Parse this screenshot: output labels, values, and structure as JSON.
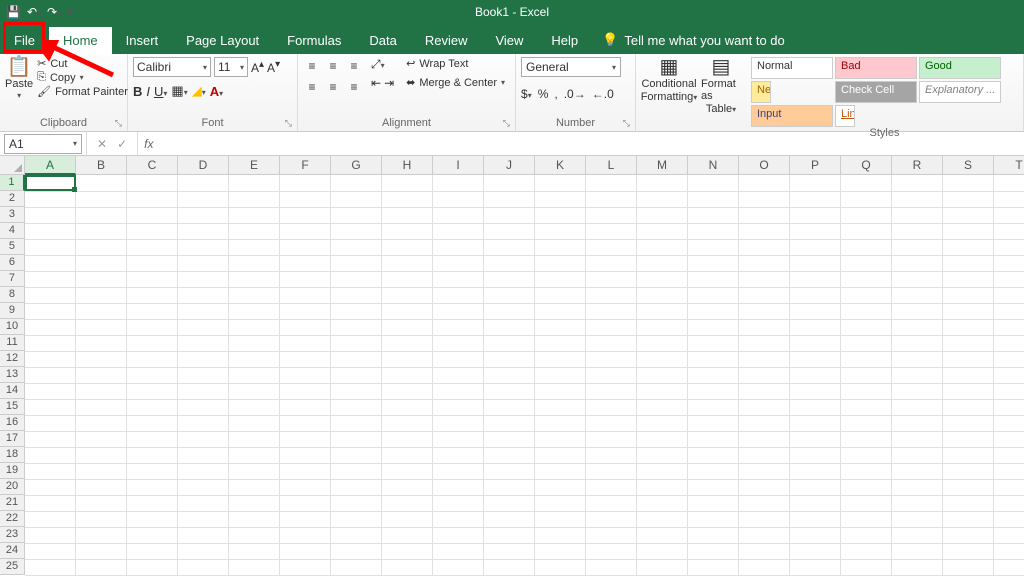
{
  "title": "Book1  -  Excel",
  "tabs": {
    "file": "File",
    "home": "Home",
    "insert": "Insert",
    "page_layout": "Page Layout",
    "formulas": "Formulas",
    "data": "Data",
    "review": "Review",
    "view": "View",
    "help": "Help",
    "tellme": "Tell me what you want to do"
  },
  "clipboard": {
    "paste": "Paste",
    "cut": "Cut",
    "copy": "Copy",
    "fp": "Format Painter",
    "label": "Clipboard"
  },
  "font": {
    "name": "Calibri",
    "size": "11",
    "label": "Font"
  },
  "alignment": {
    "wrap": "Wrap Text",
    "merge": "Merge & Center",
    "label": "Alignment"
  },
  "number": {
    "format": "General",
    "label": "Number"
  },
  "cond": {
    "cf": "Conditional",
    "cf2": "Formatting",
    "fat": "Format as",
    "fat2": "Table"
  },
  "styles": {
    "normal": "Normal",
    "bad": "Bad",
    "good": "Good",
    "neutral": "Ne",
    "check": "Check Cell",
    "explan": "Explanatory ...",
    "input": "Input",
    "link": "Lin",
    "label": "Styles"
  },
  "namebox": "A1",
  "columns": [
    "A",
    "B",
    "C",
    "D",
    "E",
    "F",
    "G",
    "H",
    "I",
    "J",
    "K",
    "L",
    "M",
    "N",
    "O",
    "P",
    "Q",
    "R",
    "S",
    "T"
  ],
  "rows": 25
}
